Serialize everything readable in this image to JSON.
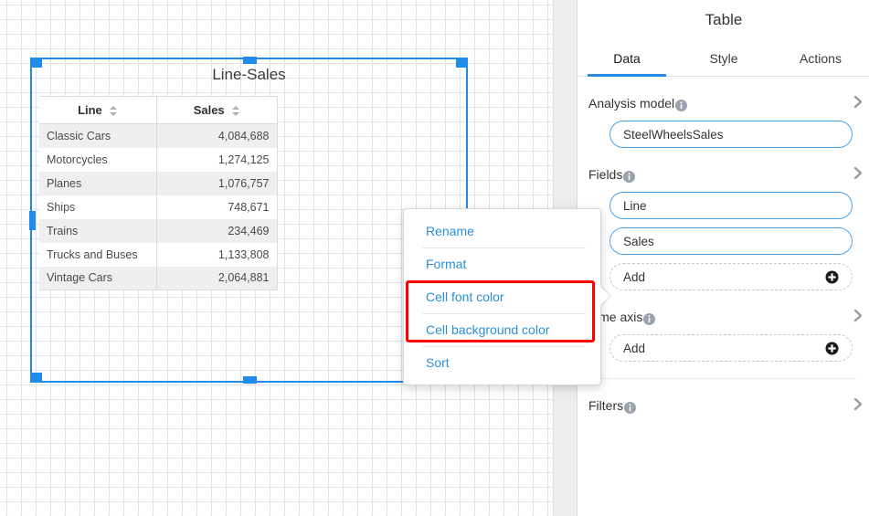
{
  "widget": {
    "title": "Line-Sales",
    "table": {
      "columns": [
        {
          "label": "Line",
          "sort_icon": "sort-updown-icon",
          "align": "left"
        },
        {
          "label": "Sales",
          "sort_icon": "sort-updown-icon",
          "align": "right"
        }
      ],
      "rows": [
        {
          "line": "Classic Cars",
          "sales": "4,084,688"
        },
        {
          "line": "Motorcycles",
          "sales": "1,274,125"
        },
        {
          "line": "Planes",
          "sales": "1,076,757"
        },
        {
          "line": "Ships",
          "sales": "748,671"
        },
        {
          "line": "Trains",
          "sales": "234,469"
        },
        {
          "line": "Trucks and Buses",
          "sales": "1,133,808"
        },
        {
          "line": "Vintage Cars",
          "sales": "2,064,881"
        }
      ]
    }
  },
  "context_menu": {
    "items": [
      {
        "label": "Rename"
      },
      {
        "label": "Format"
      },
      {
        "label": "Cell font color"
      },
      {
        "label": "Cell background color"
      },
      {
        "label": "Sort"
      }
    ],
    "highlight_color": "#ff0000",
    "text_color": "#2b8fd8"
  },
  "panel": {
    "title": "Table",
    "tabs": [
      {
        "label": "Data",
        "active": true
      },
      {
        "label": "Style",
        "active": false
      },
      {
        "label": "Actions",
        "active": false
      }
    ],
    "accent_color": "#2a8ce8",
    "sections": [
      {
        "label": "Analysis model",
        "info_icon": "info-icon",
        "chevron_icon": "chevron-right-icon",
        "pills": [
          {
            "label": "SteelWheelsSales",
            "type": "value"
          }
        ]
      },
      {
        "label": "Fields",
        "info_icon": "info-icon",
        "chevron_icon": "chevron-right-icon",
        "pills": [
          {
            "label": "Line",
            "type": "value"
          },
          {
            "label": "Sales",
            "type": "value"
          },
          {
            "label": "Add",
            "type": "add",
            "plus_icon": "plus-circle-icon"
          }
        ]
      },
      {
        "label": "Time axis",
        "info_icon": "info-icon",
        "chevron_icon": "chevron-right-icon",
        "pills": [
          {
            "label": "Add",
            "type": "add",
            "plus_icon": "plus-circle-icon"
          }
        ]
      },
      {
        "label": "Filters",
        "info_icon": "info-icon",
        "chevron_icon": "chevron-right-icon",
        "pills": []
      }
    ]
  }
}
